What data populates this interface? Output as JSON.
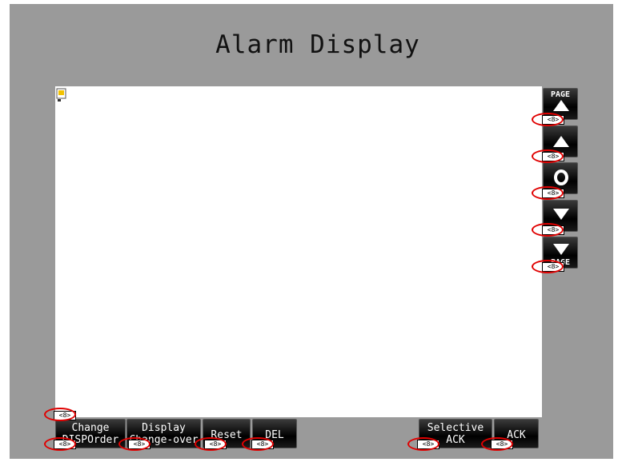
{
  "title": "Alarm Display",
  "scroll_buttons": [
    {
      "label": "PAGE",
      "icon": "page-up-icon"
    },
    {
      "label": "",
      "icon": "up-arrow-icon"
    },
    {
      "label": "",
      "icon": "circle-icon"
    },
    {
      "label": "",
      "icon": "down-arrow-icon"
    },
    {
      "label": "PAGE",
      "icon": "page-down-icon"
    }
  ],
  "bottom_buttons": {
    "change_disp_order": {
      "line1": "Change",
      "line2": "DISPOrder"
    },
    "display_changeover": {
      "line1": "Display",
      "line2": "Change-over"
    },
    "reset": "Reset",
    "del": "DEL",
    "selective_ack": {
      "line1": "Selective",
      "line2": "ACK"
    },
    "ack": "ACK"
  },
  "address_tag": "<8>",
  "colors": {
    "panel": "#9a9a9a",
    "button": "#000000",
    "highlight_ring": "#e00000"
  }
}
